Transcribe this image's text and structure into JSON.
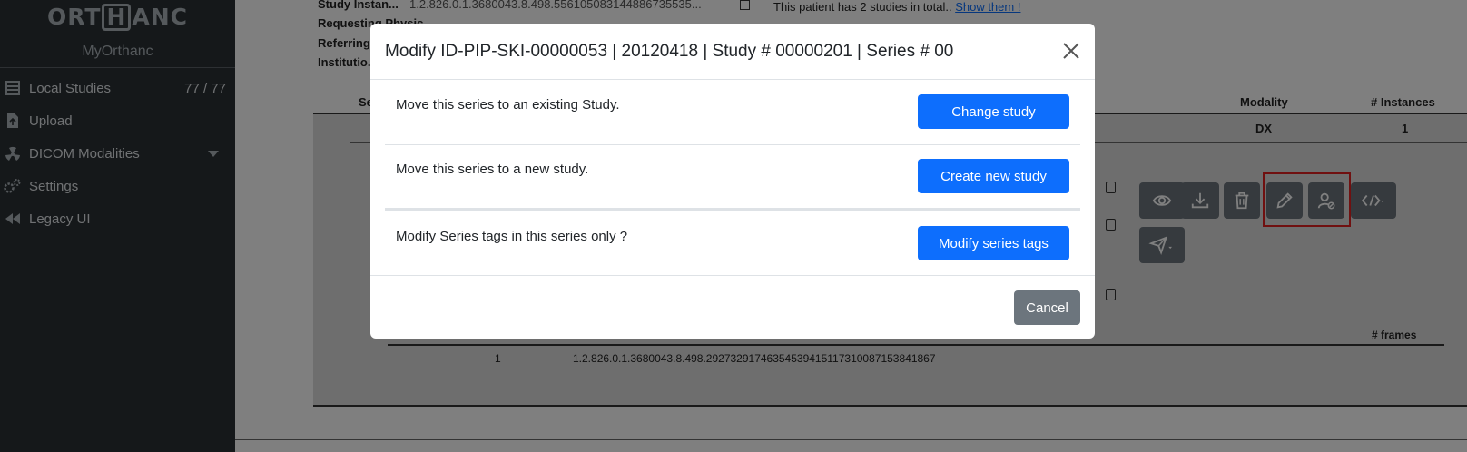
{
  "sidebar": {
    "logo_left": "ORT",
    "logo_mid": "H",
    "logo_right": "ANC",
    "site_name": "MyOrthanc",
    "items": [
      {
        "label": "Local Studies",
        "count": "77 / 77",
        "icon": "database-icon"
      },
      {
        "label": "Upload",
        "icon": "upload-file-icon"
      },
      {
        "label": "DICOM Modalities",
        "icon": "radiation-icon"
      },
      {
        "label": "Settings",
        "icon": "gears-icon"
      },
      {
        "label": "Legacy UI",
        "icon": "backward-icon"
      }
    ]
  },
  "background": {
    "study_instance_label": "Study Instan...",
    "study_instance_value": "1.2.826.0.1.3680043.8.498.556105083144886735535...",
    "requesting_label": "Requesting Physic...",
    "referring_label": "Referring...",
    "institution_label": "Institutio...",
    "patient_studies_text": "This patient has 2 studies in total..",
    "show_them_link": "Show them !",
    "col_series_partial": "Se",
    "col_modality": "Modality",
    "col_instances": "# Instances",
    "modality_value": "DX",
    "instances_value": "1",
    "col_frames": "# frames",
    "instance_number": "1",
    "instance_uid": "1.2.826.0.1.3680043.8.498.29273291746354539415117310087153841867"
  },
  "modal": {
    "title": "Modify ID-PIP-SKI-00000053 | 20120418 | Study # 00000201 | Series # 00",
    "rows": [
      {
        "text": "Move this series to an existing Study.",
        "button": "Change study"
      },
      {
        "text": "Move this series to a new study.",
        "button": "Create new study"
      },
      {
        "text": "Modify Series tags in this series only ?",
        "button": "Modify series tags"
      }
    ],
    "cancel": "Cancel"
  },
  "colors": {
    "primary": "#0d6efd",
    "secondary": "#6c757d",
    "sidebar_bg": "#2b3034",
    "highlight": "#e02020"
  }
}
